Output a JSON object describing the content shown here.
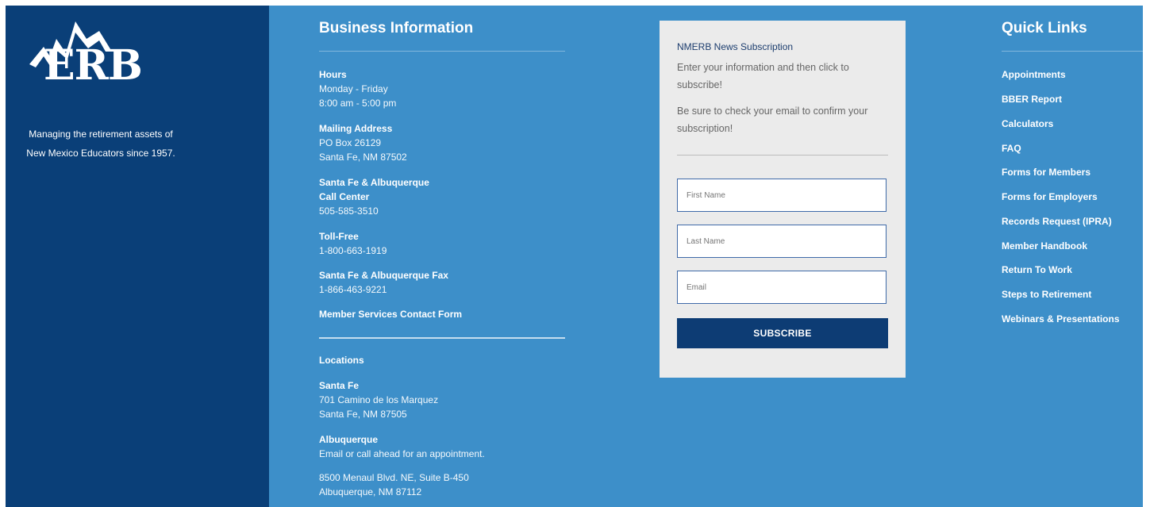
{
  "logo": {
    "text": "ERB",
    "icon": "mountain-peaks-logo"
  },
  "tagline": [
    "Managing the retirement assets of",
    "New Mexico Educators since 1957."
  ],
  "business": {
    "title": "Business Information",
    "hours_label": "Hours",
    "hours_days": "Monday - Friday",
    "hours_time": "8:00 am - 5:00 pm",
    "mailing_label": "Mailing Address",
    "mailing_line1": "PO Box 26129",
    "mailing_line2": "Santa Fe, NM 87502",
    "call_label1": "Santa Fe & Albuquerque",
    "call_label2": "Call Center",
    "call_number": "505-585-3510",
    "tollfree_label": "Toll-Free",
    "tollfree_number": "1-800-663-1919",
    "fax_label": "Santa Fe & Albuquerque Fax",
    "fax_number": "1-866-463-9221",
    "contact_form": "Member Services Contact Form",
    "locations_label": "Locations",
    "santafe_label": "Santa Fe",
    "santafe_line1": "701 Camino de los Marquez",
    "santafe_line2": "Santa Fe, NM 87505",
    "abq_label": "Albuquerque",
    "abq_note": "Email or call ahead for an appointment.",
    "abq_line1": "8500 Menaul Blvd. NE, Suite B-450",
    "abq_line2": "Albuquerque, NM 87112"
  },
  "subscription": {
    "title": "NMERB News Subscription",
    "text1": "Enter your information and then click to subscribe!",
    "text2": "Be sure to check your email to confirm your subscription!",
    "first_name_placeholder": "First Name",
    "last_name_placeholder": "Last Name",
    "email_placeholder": "Email",
    "button": "SUBSCRIBE"
  },
  "quick_links": {
    "title": "Quick Links",
    "items": [
      "Appointments",
      "BBER Report",
      "Calculators",
      "FAQ",
      "Forms for Members",
      "Forms for Employers",
      "Records Request (IPRA)",
      "Member Handbook",
      "Return To Work",
      "Steps to Retirement",
      "Webinars & Presentations"
    ]
  },
  "colors": {
    "left_panel": "#0a3f78",
    "main_bg": "#3d8fc9",
    "card_bg": "#ebebeb",
    "button": "#0d3c74"
  }
}
